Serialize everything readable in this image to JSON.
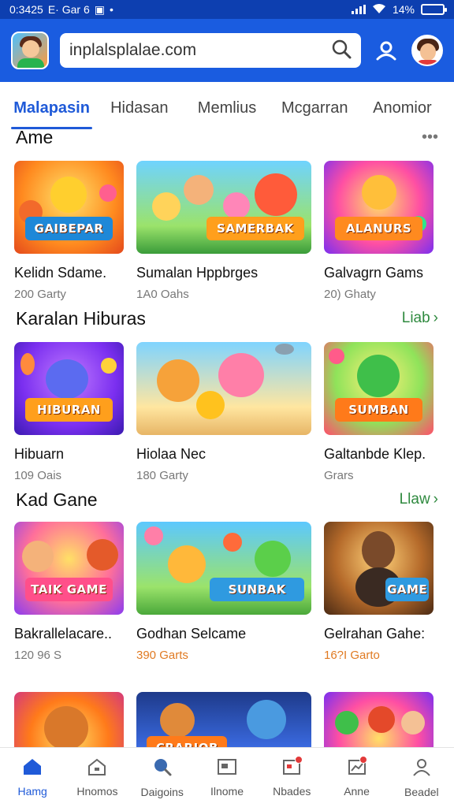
{
  "status_bar": {
    "time": "0:3425",
    "indicators": "E· Gar 6",
    "battery": "14%",
    "battery_level": 0.14
  },
  "header": {
    "search_value": "inplalsplalae.com",
    "icons": [
      "app-logo",
      "search-icon",
      "user-icon",
      "avatar"
    ]
  },
  "tabs": [
    {
      "label": "Malapasin",
      "active": true
    },
    {
      "label": "Hidasan",
      "active": false
    },
    {
      "label": "Memlius",
      "active": false
    },
    {
      "label": "Mcgarran",
      "active": false
    },
    {
      "label": "Anomior",
      "active": false
    }
  ],
  "sections": [
    {
      "title": "Ame",
      "more": "•••",
      "cards": [
        {
          "name": "Kelidn Sdame.",
          "meta": "200 Garty",
          "art": "GAIBEPAR"
        },
        {
          "name": "Sumalan Hppbrges",
          "meta": "1A0 Oahs",
          "art": "SAMERBAK"
        },
        {
          "name": "Galvagrn Gams",
          "meta": "20) Ghaty",
          "art": "ALANURS"
        }
      ]
    },
    {
      "title": "Karalan Hiburas",
      "more": "Liab",
      "cards": [
        {
          "name": "Hibuarn",
          "meta": "109 Oais",
          "art": "HIBURAN"
        },
        {
          "name": "Hiolaa Nec",
          "meta": "180 Garty",
          "art": ""
        },
        {
          "name": "Galtanbde Klep.",
          "meta": "Grars",
          "art": "SUMBAN"
        }
      ]
    },
    {
      "title": "Kad Gane",
      "more": "Llaw",
      "cards": [
        {
          "name": "Bakrallelacare..",
          "meta": "120 96 S",
          "art": "TAIK GAME"
        },
        {
          "name": "Godhan Selcame",
          "meta": "390 Garts",
          "art": "SUNBAK"
        },
        {
          "name": "Gelrahan Gahe:",
          "meta": "16?I Garto",
          "art": "GAME"
        }
      ]
    },
    {
      "title": "",
      "cards": [
        {
          "art": ""
        },
        {
          "art": "CRARJOB"
        },
        {
          "art": ""
        }
      ]
    }
  ],
  "bottom_nav": [
    {
      "label": "Hamg",
      "icon": "home-icon",
      "active": true
    },
    {
      "label": "Hnomos",
      "icon": "house-icon",
      "active": false
    },
    {
      "label": "Daigoins",
      "icon": "search-icon",
      "active": false
    },
    {
      "label": "Ilnome",
      "icon": "gallery-icon",
      "active": false
    },
    {
      "label": "Nbades",
      "icon": "badge-icon",
      "active": false,
      "dot": true
    },
    {
      "label": "Anne",
      "icon": "chart-icon",
      "active": false,
      "dot": true
    },
    {
      "label": "Beadel",
      "icon": "profile-icon",
      "active": false
    }
  ],
  "colors": {
    "primary": "#1a5ce0",
    "status_bar": "#0d3fb0",
    "active_tab": "#1f5ad8",
    "more_link": "#2f8a3f",
    "meta_orange": "#e07a22"
  }
}
